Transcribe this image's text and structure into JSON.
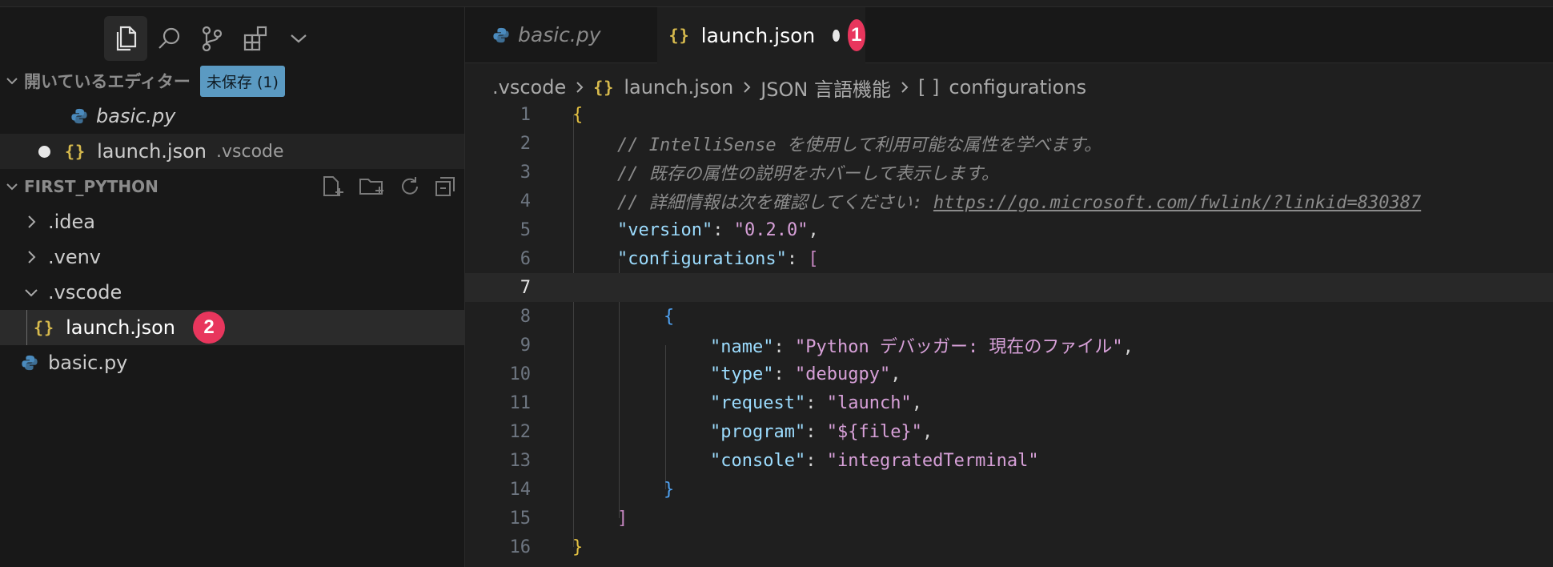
{
  "sidebar": {
    "activity_icons": [
      "explorer-icon",
      "search-icon",
      "source-control-icon",
      "extensions-icon",
      "chevron-down-icon"
    ],
    "open_editors": {
      "title": "開いているエディター",
      "badge": "未保存 (1)",
      "items": [
        {
          "name": "basic.py",
          "icon": "python-icon"
        },
        {
          "name": "launch.json",
          "suffix": ".vscode",
          "icon": "json-icon",
          "modified": true
        }
      ]
    },
    "project": {
      "title": "FIRST_PYTHON",
      "toolbar_icons": [
        "new-file-icon",
        "new-folder-icon",
        "refresh-icon",
        "collapse-all-icon"
      ],
      "tree": [
        {
          "label": ".idea",
          "type": "folder",
          "expanded": false
        },
        {
          "label": ".venv",
          "type": "folder",
          "expanded": false
        },
        {
          "label": ".vscode",
          "type": "folder",
          "expanded": true
        },
        {
          "label": "launch.json",
          "type": "file",
          "icon": "json-icon",
          "selected": true
        },
        {
          "label": "basic.py",
          "type": "file",
          "icon": "python-icon"
        }
      ]
    },
    "callout2": "2"
  },
  "editor": {
    "tabs": [
      {
        "label": "basic.py",
        "icon": "python-icon",
        "active": false
      },
      {
        "label": "launch.json",
        "icon": "json-icon",
        "active": true,
        "modified": true
      }
    ],
    "callout1": "1",
    "json_icon_text": "{}",
    "breadcrumb": [
      ".vscode",
      "launch.json",
      "JSON 言語機能",
      "configurations"
    ],
    "breadcrumb_array_icon": "[ ]",
    "current_line": 7,
    "lines": [
      {
        "n": "1",
        "t": "{"
      },
      {
        "n": "2",
        "t": "// IntelliSense を使用して利用可能な属性を学べます。"
      },
      {
        "n": "3",
        "t": "// 既存の属性の説明をホバーして表示します。"
      },
      {
        "n": "4",
        "t": "// 詳細情報は次を確認してください: ",
        "link": "https://go.microsoft.com/fwlink/?linkid=830387"
      },
      {
        "n": "5",
        "k": "\"version\"",
        "v": "\"0.2.0\"",
        "end": ","
      },
      {
        "n": "6",
        "k": "\"configurations\"",
        "v": "[",
        "end": ""
      },
      {
        "n": "7",
        "t": ""
      },
      {
        "n": "8",
        "t": "{"
      },
      {
        "n": "9",
        "k": "\"name\"",
        "v": "\"Python デバッガー: 現在のファイル\"",
        "end": ","
      },
      {
        "n": "10",
        "k": "\"type\"",
        "v": "\"debugpy\"",
        "end": ","
      },
      {
        "n": "11",
        "k": "\"request\"",
        "v": "\"launch\"",
        "end": ","
      },
      {
        "n": "12",
        "k": "\"program\"",
        "v": "\"${file}\"",
        "end": ","
      },
      {
        "n": "13",
        "k": "\"console\"",
        "v": "\"integratedTerminal\"",
        "end": ""
      },
      {
        "n": "14",
        "t": "}"
      },
      {
        "n": "15",
        "t": "]"
      },
      {
        "n": "16",
        "t": "}"
      }
    ]
  },
  "colors": {
    "callout": "#e8365d",
    "badge": "#5b9ac2",
    "json_icon": "#d7ba4d",
    "python_icon": "#4b8bbe"
  }
}
